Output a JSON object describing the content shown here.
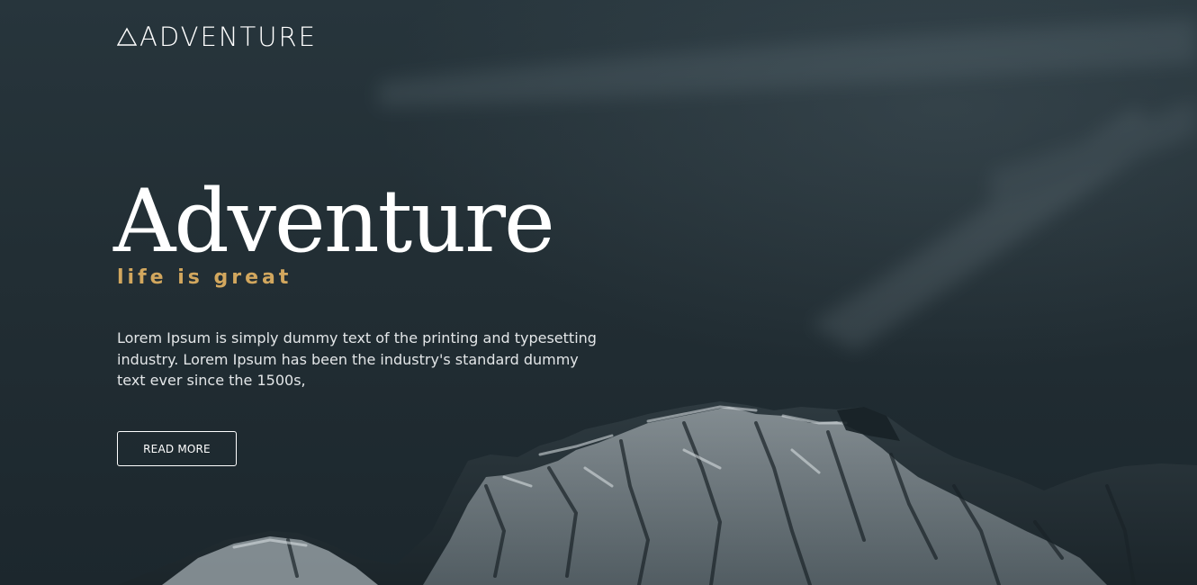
{
  "header": {
    "logo_text": "ADVENTURE",
    "logo_icon": "triangle-icon"
  },
  "hero": {
    "title": "Adventure",
    "tagline": "life is great",
    "description": "Lorem Ipsum is simply dummy text of the printing and typesetting industry. Lorem Ipsum has been the industry's standard dummy text ever since the 1500s,",
    "button_label": "READ MORE",
    "background": "mountain-image"
  },
  "colors": {
    "background_dark": "#1f2b31",
    "accent_gold": "#d2a75e",
    "text_white": "#ffffff",
    "text_light": "#e3e6e8"
  }
}
